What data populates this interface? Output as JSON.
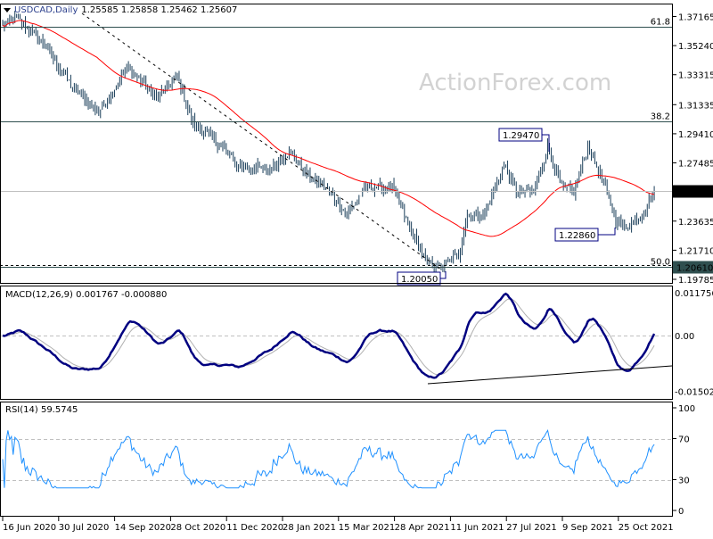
{
  "header": {
    "symbol": "USDCAD,Daily",
    "ohlc": "1.25585 1.25858 1.25462 1.25607"
  },
  "watermark": "ActionForex.com",
  "colors": {
    "bars": "#1b3f5a",
    "ma": "#ff0000",
    "macd": "#000080",
    "signal": "#b0b0b0",
    "rsi": "#1e90ff",
    "last_price_bg": "#000000",
    "level_bg": "#2f4f4f"
  },
  "chart_data": [
    {
      "type": "ohlc",
      "title": "USDCAD,Daily",
      "ylim": [
        1.19785,
        1.37165
      ],
      "y_ticks": [
        "1.37165",
        "1.35240",
        "1.33315",
        "1.31335",
        "1.29410",
        "1.27485",
        "1.23635",
        "1.21710",
        "1.19785"
      ],
      "x_ticks": [
        "16 Jun 2020",
        "30 Jul 2020",
        "14 Sep 2020",
        "28 Oct 2020",
        "11 Dec 2020",
        "28 Jan 2021",
        "15 Mar 2021",
        "28 Apr 2021",
        "11 Jun 2021",
        "27 Jul 2021",
        "9 Sep 2021",
        "25 Oct 2021"
      ],
      "close_anchors": [
        [
          0,
          1.3649
        ],
        [
          8,
          1.3708
        ],
        [
          24,
          1.3531
        ],
        [
          39,
          1.3265
        ],
        [
          55,
          1.3088
        ],
        [
          72,
          1.3383
        ],
        [
          88,
          1.3177
        ],
        [
          100,
          1.3324
        ],
        [
          108,
          1.3029
        ],
        [
          126,
          1.2852
        ],
        [
          134,
          1.2734
        ],
        [
          152,
          1.2705
        ],
        [
          164,
          1.2823
        ],
        [
          174,
          1.2675
        ],
        [
          187,
          1.2557
        ],
        [
          197,
          1.241
        ],
        [
          208,
          1.2587
        ],
        [
          223,
          1.2587
        ],
        [
          233,
          1.2321
        ],
        [
          243,
          1.2085
        ],
        [
          251,
          1.2056
        ],
        [
          261,
          1.2144
        ],
        [
          266,
          1.241
        ],
        [
          276,
          1.241
        ],
        [
          287,
          1.2734
        ],
        [
          294,
          1.2557
        ],
        [
          304,
          1.2557
        ],
        [
          312,
          1.2852
        ],
        [
          320,
          1.2587
        ],
        [
          327,
          1.2557
        ],
        [
          335,
          1.2852
        ],
        [
          343,
          1.2646
        ],
        [
          351,
          1.238
        ],
        [
          356,
          1.2321
        ],
        [
          366,
          1.241
        ],
        [
          373,
          1.25607
        ]
      ],
      "moving_average_period": 55,
      "last_price": "1.25607",
      "level_label": "1.20610",
      "fib_levels": [
        {
          "label": "61.8",
          "value": 1.3649
        },
        {
          "label": "38.2",
          "value": 1.3025
        },
        {
          "label": "50.0",
          "value": 1.2061
        }
      ],
      "annotations": [
        {
          "text": "1.29470",
          "bar": 312,
          "value": 1.2947
        },
        {
          "text": "1.22860",
          "bar": 352,
          "value": 1.2286
        },
        {
          "text": "1.20050",
          "bar": 250,
          "value": 1.2005
        }
      ]
    },
    {
      "type": "line",
      "title": "MACD(12,26,9) 0.001767 -0.000880",
      "ylim": [
        -0.01502,
        0.011756
      ],
      "y_ticks": [
        "0.011756",
        "0.00",
        "-0.01502"
      ]
    },
    {
      "type": "line",
      "title": "RSI(14) 59.5745",
      "ylim": [
        0,
        100
      ],
      "y_ticks": [
        "100",
        "70",
        "30",
        "0"
      ],
      "levels": [
        70,
        30
      ]
    }
  ]
}
